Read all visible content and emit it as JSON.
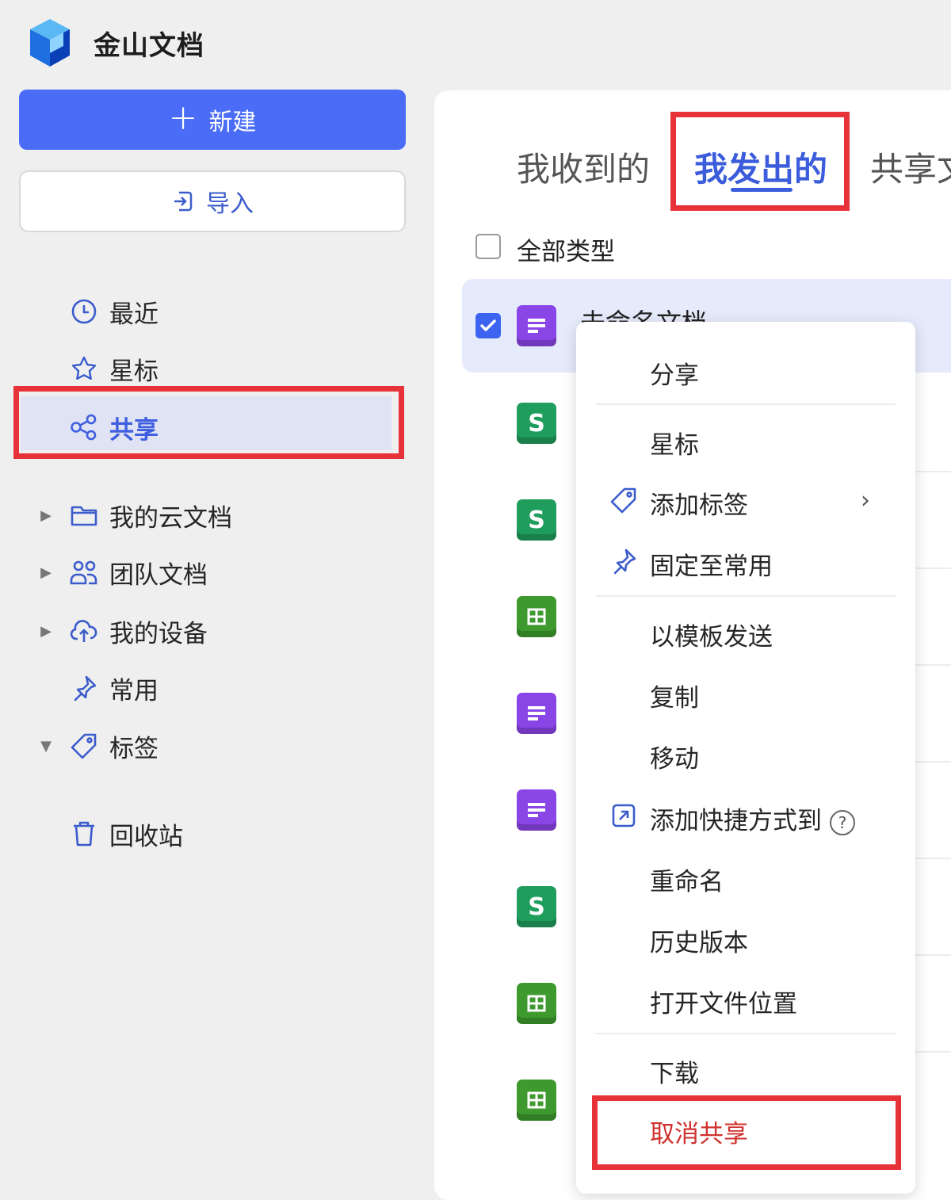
{
  "app": {
    "title": "金山文档"
  },
  "sidebar": {
    "new_label": "新建",
    "import_label": "导入",
    "items": [
      {
        "label": "最近"
      },
      {
        "label": "星标"
      },
      {
        "label": "共享"
      },
      {
        "label": "我的云文档"
      },
      {
        "label": "团队文档"
      },
      {
        "label": "我的设备"
      },
      {
        "label": "常用"
      },
      {
        "label": "标签"
      },
      {
        "label": "回收站"
      }
    ]
  },
  "main": {
    "tabs": [
      {
        "label": "我收到的"
      },
      {
        "label": "我发出的"
      },
      {
        "label": "共享文"
      }
    ],
    "filter_label": "全部类型",
    "selected_file_name": "未命名文档"
  },
  "menu": {
    "items": [
      {
        "label": "分享"
      },
      {
        "label": "星标"
      },
      {
        "label": "添加标签"
      },
      {
        "label": "固定至常用"
      },
      {
        "label": "以模板发送"
      },
      {
        "label": "复制"
      },
      {
        "label": "移动"
      },
      {
        "label": "添加快捷方式到"
      },
      {
        "label": "重命名"
      },
      {
        "label": "历史版本"
      },
      {
        "label": "打开文件位置"
      },
      {
        "label": "下载"
      },
      {
        "label": "取消共享"
      }
    ]
  },
  "colors": {
    "primary": "#4a6cf7",
    "highlight": "#e8323a",
    "danger": "#d0322e"
  }
}
